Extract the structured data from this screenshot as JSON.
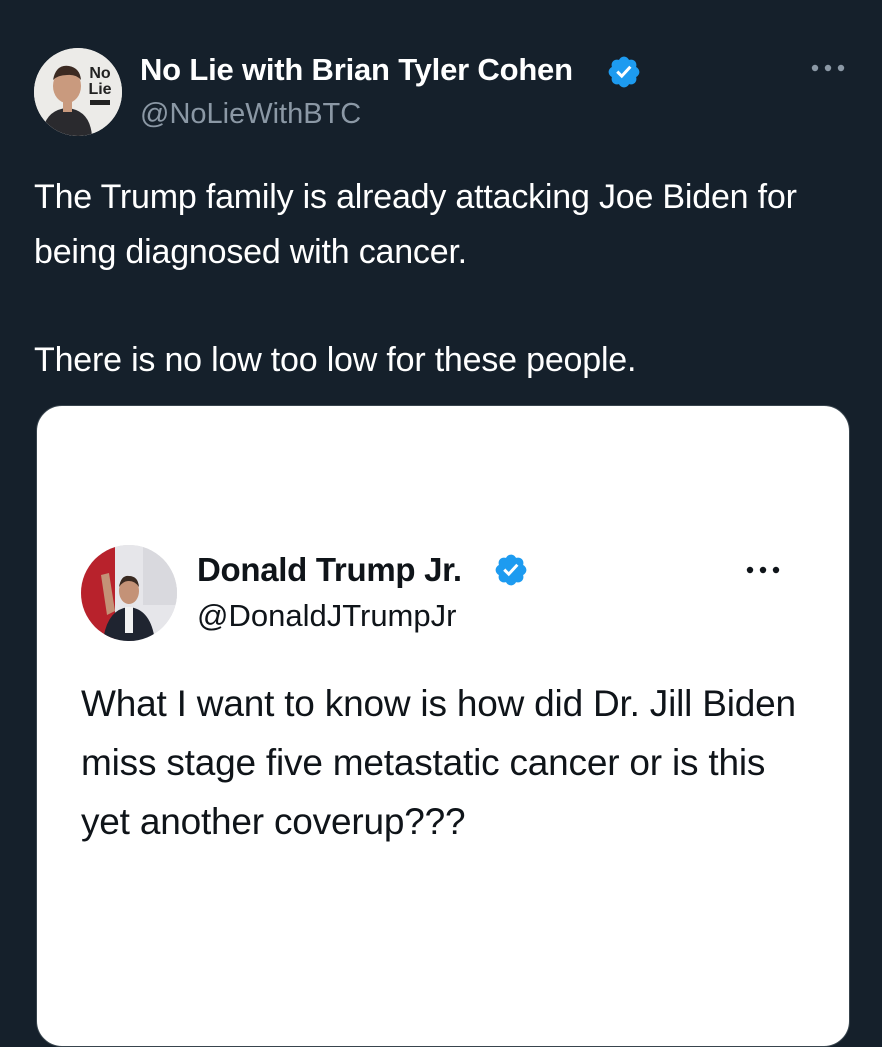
{
  "tweet": {
    "author": {
      "name": "No Lie with Brian Tyler Cohen",
      "handle": "@NoLieWithBTC",
      "avatar_logo_text": [
        "No",
        "Lie"
      ]
    },
    "text_lines": [
      "The Trump family is already attacking Joe Biden for being diagnosed with cancer.",
      "There is no low too low for these people."
    ],
    "more_icon": "ellipsis-icon",
    "verified_icon": "verified-badge-icon"
  },
  "quoted": {
    "author": {
      "name": "Donald Trump Jr.",
      "handle": "@DonaldJTrumpJr"
    },
    "text": "What I want to know is how did Dr. Jill Biden miss stage five metastatic cancer or is this yet another coverup???",
    "more_icon": "ellipsis-icon",
    "verified_icon": "verified-badge-icon"
  },
  "colors": {
    "background": "#15202b",
    "verified_blue": "#1d9bf0",
    "secondary_text": "#8b98a5",
    "card_background": "#ffffff"
  }
}
